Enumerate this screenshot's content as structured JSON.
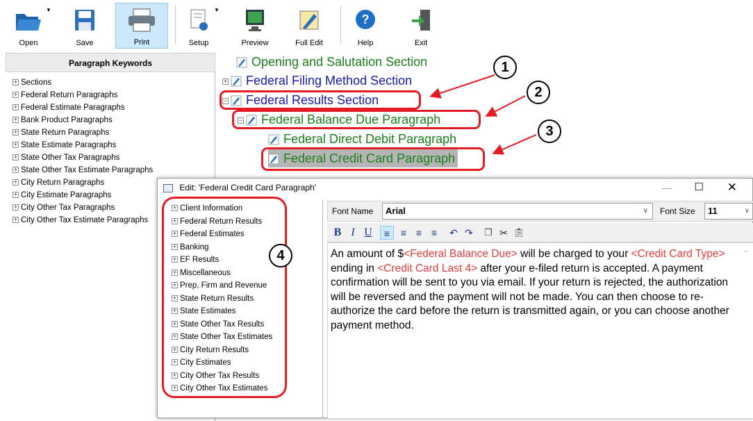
{
  "toolbar": {
    "open": "Open",
    "save": "Save",
    "print": "Print",
    "setup": "Setup",
    "preview": "Preview",
    "full_edit": "Full Edit",
    "help": "Help",
    "exit": "Exit"
  },
  "left_panel": {
    "title": "Paragraph Keywords",
    "items": [
      "Sections",
      "Federal Return Paragraphs",
      "Federal Estimate Paragraphs",
      "Bank Product Paragraphs",
      "State Return Paragraphs",
      "State Estimate Paragraphs",
      "State Other Tax Paragraphs",
      "State Other Tax Estimate Paragraphs",
      "City Return Paragraphs",
      "City Estimate Paragraphs",
      "City Other Tax Paragraphs",
      "City Other Tax Estimate Paragraphs"
    ]
  },
  "outline": {
    "opening": "Opening and Salutation Section",
    "filing_method": "Federal Filing Method Section",
    "results": "Federal Results Section",
    "balance_due": "Federal Balance Due Paragraph",
    "direct_debit": "Federal Direct Debit Paragraph",
    "credit_card": "Federal Credit Card Paragraph"
  },
  "callouts": [
    "1",
    "2",
    "3",
    "4"
  ],
  "dialog": {
    "title": "Edit: 'Federal Credit Card Paragraph'",
    "items": [
      "Client Information",
      "Federal Return Results",
      "Federal Estimates",
      "Banking",
      "EF Results",
      "Miscellaneous",
      "Prep, Firm and Revenue",
      "State Return Results",
      "State Estimates",
      "State Other Tax Results",
      "State Other Tax Estimates",
      "City Return Results",
      "City Estimates",
      "City Other Tax Results",
      "City Other Tax Estimates"
    ],
    "font_name_label": "Font Name",
    "font_name": "Arial",
    "font_size_label": "Font Size",
    "font_size": "11",
    "body": {
      "t1": "An amount of $",
      "k1": "<Federal Balance Due>",
      "t2": " will be charged to your ",
      "k2": "<Credit Card Type>",
      "t3": " ending in ",
      "k3": "<Credit Card Last 4>",
      "t4": " after your e-filed return is accepted. A payment confirmation will be sent to you via email. If your return is rejected, the authorization will be reversed and the payment will not be made. You can then choose to re-authorize the card before the return is transmitted again, or you can choose another payment method."
    }
  },
  "colors": {
    "highlight": "#e41b23",
    "keyword": "#e03c3c",
    "section_green": "#1b7f1b",
    "section_blue": "#1a1aa8"
  }
}
